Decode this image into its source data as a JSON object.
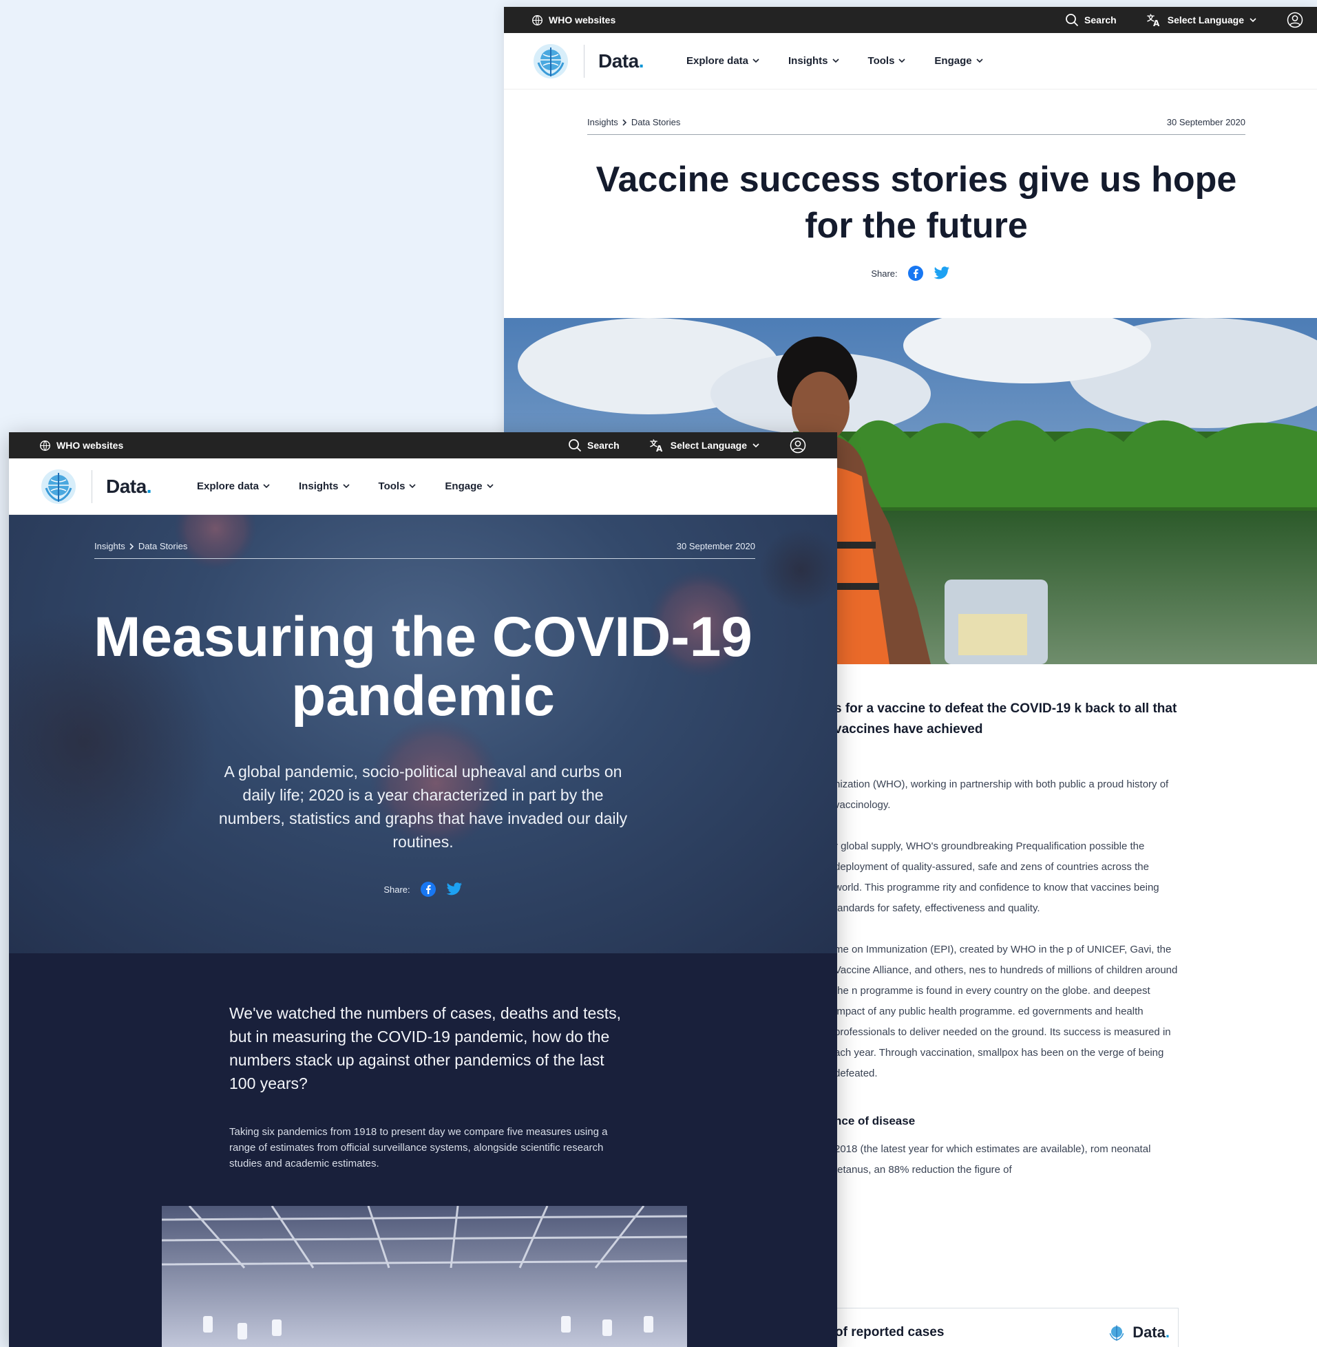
{
  "colors": {
    "page_background": "#eaf2fb",
    "topbar": "#232323",
    "accent": "#0093d5",
    "facebook": "#1877f2",
    "twitter": "#1da1f2",
    "front_hero": "#33496b",
    "front_body": "#19203b"
  },
  "back_window": {
    "topbar": {
      "who_websites": "WHO websites",
      "search": "Search",
      "select_language": "Select Language"
    },
    "brand": {
      "text": "Data",
      "dot": "."
    },
    "nav": [
      "Explore data",
      "Insights",
      "Tools",
      "Engage"
    ],
    "breadcrumb": {
      "parent": "Insights",
      "current": "Data Stories"
    },
    "date": "30 September 2020",
    "title": "Vaccine success stories give us hope for the future",
    "share_label": "Share:",
    "article": {
      "lead": "s for a vaccine to defeat the COVID-19 k back to all that vaccines have achieved",
      "para1": "nization (WHO), working in partnership with both public a proud history of vaccinology.",
      "para2": "r global supply, WHO's groundbreaking Prequalification possible the deployment of quality-assured, safe and zens of countries across the world. This programme rity and confidence to know that vaccines being tandards for safety, effectiveness and quality.",
      "para3": "me on Immunization (EPI), created by WHO in the p of UNICEF, Gavi, the Vaccine Alliance, and others, nes to hundreds of millions of children around the n programme is found in every country on the globe. and deepest impact of any public health programme. ed governments and health professionals to deliver needed on the ground. Its success is measured in ach year. Through vaccination, smallpox has been on the verge of being defeated.",
      "heading": "nce of disease",
      "para4": "2018 (the latest year for which estimates are available), rom neonatal tetanus, an 88% reduction the figure of"
    },
    "chart_card": {
      "title": "of reported cases",
      "logo_text": "Data",
      "logo_dot": "."
    }
  },
  "front_window": {
    "topbar": {
      "who_websites": "WHO websites",
      "search": "Search",
      "select_language": "Select Language"
    },
    "brand": {
      "text": "Data",
      "dot": "."
    },
    "nav": [
      "Explore data",
      "Insights",
      "Tools",
      "Engage"
    ],
    "breadcrumb": {
      "parent": "Insights",
      "current": "Data Stories"
    },
    "date": "30 September 2020",
    "title": "Measuring the COVID-19 pandemic",
    "subtitle": "A global pandemic, socio-political upheaval and curbs on daily life; 2020 is a year characterized in part by the numbers, statistics and graphs that have invaded our daily routines.",
    "share_label": "Share:",
    "lead": "We've watched the numbers of cases, deaths and tests, but in measuring the COVID-19 pandemic, how do the numbers stack up against other pandemics of the last 100 years?",
    "paragraph": "Taking six pandemics from 1918 to present day we compare five measures using a range of estimates  from official surveillance systems, alongside scientific research studies and academic estimates."
  },
  "icons": {
    "globe": "globe-icon",
    "search": "search-icon",
    "translate": "translate-icon",
    "chevron": "chevron-down-icon",
    "account": "account-icon",
    "facebook": "facebook-icon",
    "twitter": "twitter-icon",
    "who_emblem": "who-emblem-icon"
  }
}
